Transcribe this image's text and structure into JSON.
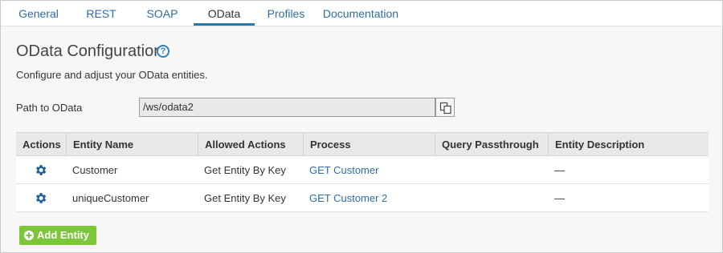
{
  "tabs": [
    {
      "label": "General"
    },
    {
      "label": "REST"
    },
    {
      "label": "SOAP"
    },
    {
      "label": "OData",
      "active": true
    },
    {
      "label": "Profiles"
    },
    {
      "label": "Documentation"
    }
  ],
  "page": {
    "title": "OData Configuration",
    "help_icon": "question-circle-icon",
    "subtitle": "Configure and adjust your OData entities."
  },
  "path": {
    "label": "Path to OData",
    "value": "/ws/odata2",
    "copy_icon": "copy-icon"
  },
  "table": {
    "headers": [
      "Actions",
      "Entity Name",
      "Allowed Actions",
      "Process",
      "Query Passthrough",
      "Entity Description"
    ],
    "rows": [
      {
        "action_icon": "gear-icon",
        "entity_name": "Customer",
        "allowed_actions": "Get Entity By Key",
        "process": "GET Customer",
        "query_passthrough": "",
        "entity_description": "—"
      },
      {
        "action_icon": "gear-icon",
        "entity_name": "uniqueCustomer",
        "allowed_actions": "Get Entity By Key",
        "process": "GET Customer 2",
        "query_passthrough": "",
        "entity_description": "—"
      }
    ]
  },
  "add_button": {
    "label": "Add Entity",
    "icon": "plus-circle-icon"
  },
  "colors": {
    "link": "#2e6da4",
    "active_tab_underline": "#1f7ab5",
    "gear": "#1f5f9a",
    "add_button": "#7cc63c"
  }
}
